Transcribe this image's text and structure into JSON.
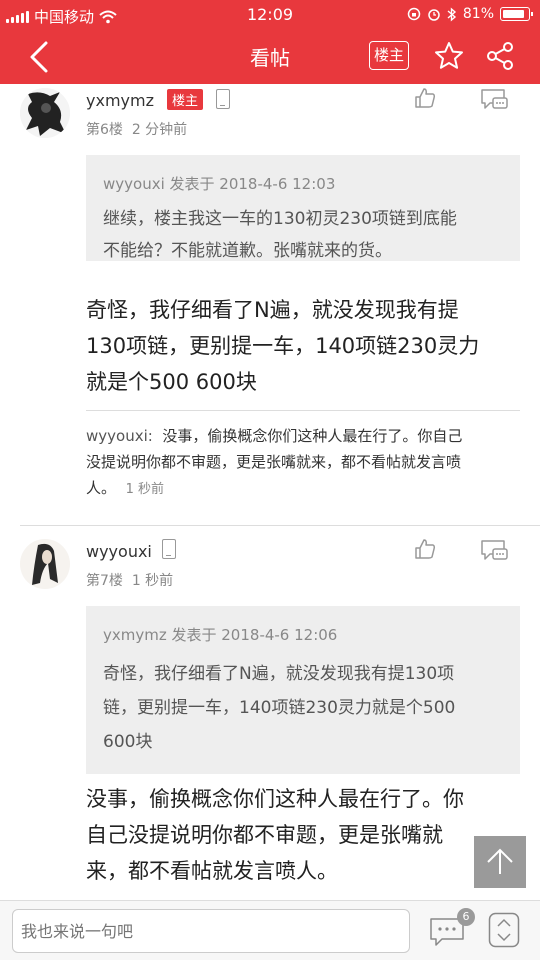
{
  "status_bar": {
    "carrier": "中国移动",
    "time": "12:09",
    "battery": "81%"
  },
  "nav": {
    "title": "看帖",
    "owner_button": "楼主"
  },
  "posts": [
    {
      "username": "yxmymz",
      "owner_tag": "楼主",
      "floor": "第6楼",
      "time": "2 分钟前",
      "quote": {
        "meta": "wyyouxi 发表于 2018-4-6 12:03",
        "text_lines": [
          "继续，楼主我这一车的130初灵230项链到底能",
          "不能给？不能就道歉。张嘴就来的货。"
        ]
      },
      "body_lines": [
        "奇怪，我仔细看了N遍，就没发现我有提",
        "130项链，更别提一车，140项链230灵力",
        "就是个500 600块"
      ],
      "reply": {
        "name": "wyyouxi:",
        "lines": [
          "没事，偷换概念你们这种人最在行了。你自己",
          "没提说明你都不审题，更是张嘴就来，都不看帖就发言喷",
          "人。"
        ],
        "time": "1 秒前"
      }
    },
    {
      "username": "wyyouxi",
      "floor": "第7楼",
      "time": "1 秒前",
      "quote": {
        "meta": "yxmymz 发表于 2018-4-6 12:06",
        "text_lines": [
          "奇怪，我仔细看了N遍，就没发现我有提130项",
          "链，更别提一车，140项链230灵力就是个500",
          "600块"
        ]
      },
      "body_lines": [
        "没事，偷换概念你们这种人最在行了。你",
        "自己没提说明你都不审题，更是张嘴就",
        "来，都不看帖就发言喷人。"
      ]
    }
  ],
  "bottom_bar": {
    "placeholder": "我也来说一句吧",
    "comment_count": "6"
  },
  "colors": {
    "brand_red": "#e8383d"
  },
  "icons": [
    "back-icon",
    "star-icon",
    "share-icon",
    "like-icon",
    "reply-icon",
    "phone-icon",
    "arrow-up-icon",
    "comment-icon",
    "updown-icon"
  ]
}
